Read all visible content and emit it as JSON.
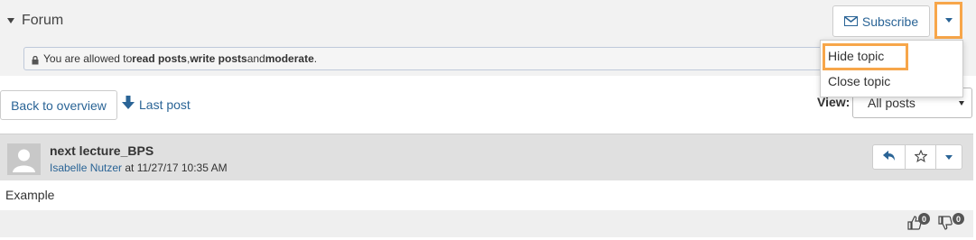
{
  "forum": {
    "title": "Forum",
    "subscribe_label": "Subscribe",
    "permissions": {
      "prefix": "You are allowed to ",
      "read": "read posts",
      "sep1": ", ",
      "write": "write posts",
      "sep2": " and ",
      "moderate": "moderate",
      "suffix": "."
    }
  },
  "dropdown": {
    "items": [
      {
        "label": "Hide topic"
      },
      {
        "label": "Close topic"
      }
    ]
  },
  "nav": {
    "back_label": "Back to overview",
    "last_post_label": "Last post",
    "view_label": "View:",
    "view_value": "All posts"
  },
  "post": {
    "title": "next lecture_BPS",
    "author": "Isabelle Nutzer",
    "at_text": " at 11/27/17 10:35 AM",
    "body": "Example",
    "likes": "0",
    "dislikes": "0"
  },
  "colors": {
    "accent": "#2a6496",
    "highlight": "#f7a64a"
  },
  "icons": {
    "toggle": "caret-down-icon",
    "subscribe": "envelope-icon",
    "lock": "lock-icon",
    "last_post": "arrow-down-icon",
    "reply": "reply-icon",
    "star": "star-icon",
    "like": "thumbs-up-icon",
    "dislike": "thumbs-down-icon"
  }
}
